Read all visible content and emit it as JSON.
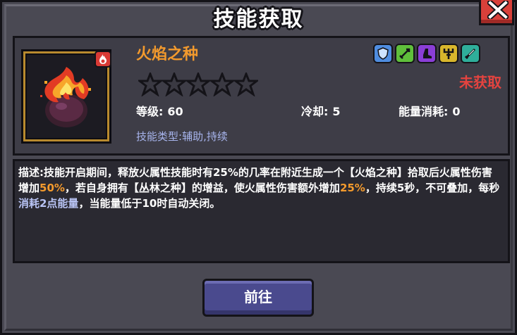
{
  "dialog": {
    "title": "技能获取",
    "close_icon": "close-icon"
  },
  "skill": {
    "name": "火焰之种",
    "status": "未获取",
    "stars_total": 5,
    "stars_filled": 0,
    "element_badge_icon": "fire-icon",
    "tags": [
      {
        "icon": "shield-icon",
        "color": "#4f8de0"
      },
      {
        "icon": "sword-icon",
        "color": "#5fbf3b"
      },
      {
        "icon": "boot-icon",
        "color": "#8a3ed6"
      },
      {
        "icon": "trident-icon",
        "color": "#d8b62c"
      },
      {
        "icon": "blade-icon",
        "color": "#2fae9a"
      }
    ],
    "level_label": "等级:",
    "level_value": "60",
    "cooldown_label": "冷却:",
    "cooldown_value": "5",
    "energy_label": "能量消耗:",
    "energy_value": "0",
    "type_label": "技能类型:",
    "type_value": "辅助,持续"
  },
  "description": {
    "p1": "描述:技能开启期间，释放火属性技能时有25%的几率在附近生成一个【火焰之种】拾取后火属性伤害增加",
    "p2": "50%",
    "p3": "，若自身拥有【丛林之种】的增益，使火属性伤害额外增加",
    "p4": "25%",
    "p5": "，持续5秒，不可叠加，每秒",
    "p6": "消耗2点能量",
    "p7": "，当能量低于10时自动关闭。"
  },
  "actions": {
    "go_label": "前往"
  }
}
